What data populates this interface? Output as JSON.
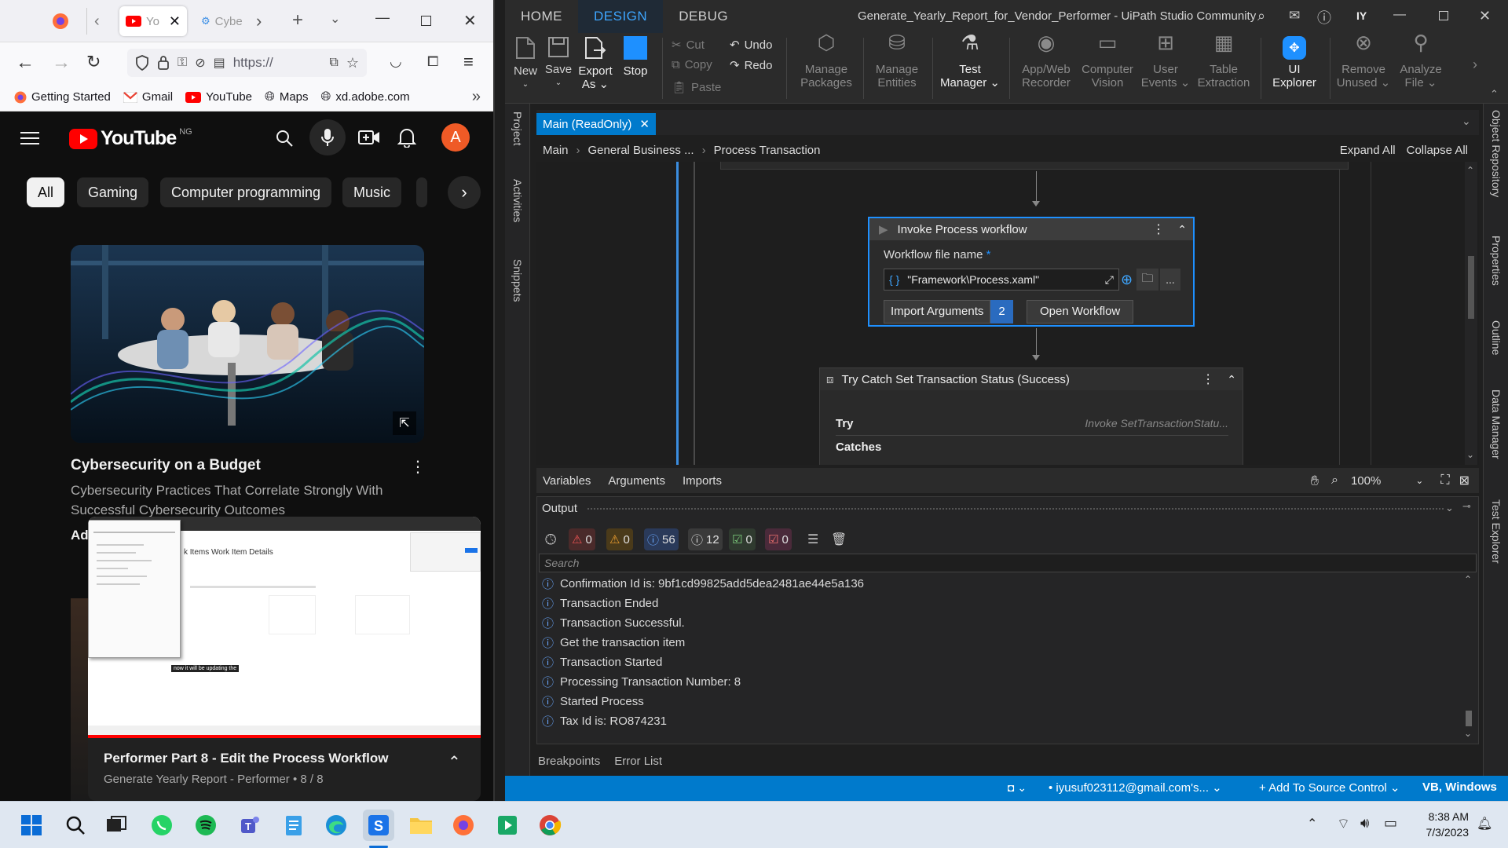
{
  "firefox": {
    "tabs": [
      {
        "label": "Yo"
      },
      {
        "label": "Cybe"
      }
    ],
    "url": "https://",
    "bookmarks": [
      "Getting Started",
      "Gmail",
      "YouTube",
      "Maps",
      "xd.adobe.com"
    ]
  },
  "youtube": {
    "logo_text": "YouTube",
    "country": "NG",
    "avatar_letter": "A",
    "chips": [
      "All",
      "Gaming",
      "Computer programming",
      "Music"
    ],
    "video1": {
      "title": "Cybersecurity on a Budget",
      "desc": "Cybersecurity Practices That Correlate Strongly With Successful Cybersecurity Outcomes",
      "ad": "Ad"
    },
    "miniplayer": {
      "title": "Performer Part 8  - Edit the Process Workflow",
      "subtitle": "Generate Yearly Report - Performer • 8 / 8",
      "caption": "now it will be updating the",
      "frame_tabs": "k Items   Work Item Details"
    }
  },
  "uipath": {
    "menu_tabs": [
      "HOME",
      "DESIGN",
      "DEBUG"
    ],
    "title": "Generate_Yearly_Report_for_Vendor_Performer - UiPath Studio Community",
    "user": "IY",
    "ribbon": {
      "new": "New",
      "save": "Save",
      "export": "Export",
      "export2": "As",
      "stop": "Stop",
      "cut": "Cut",
      "copy": "Copy",
      "paste": "Paste",
      "undo": "Undo",
      "redo": "Redo",
      "manage_packages": [
        "Manage",
        "Packages"
      ],
      "manage_entities": [
        "Manage",
        "Entities"
      ],
      "test_manager": [
        "Test",
        "Manager"
      ],
      "app_web_recorder": [
        "App/Web",
        "Recorder"
      ],
      "computer_vision": [
        "Computer",
        "Vision"
      ],
      "user_events": [
        "User",
        "Events"
      ],
      "table_extraction": [
        "Table",
        "Extraction"
      ],
      "ui_explorer": [
        "UI",
        "Explorer"
      ],
      "remove_unused": [
        "Remove",
        "Unused"
      ],
      "analyze_file": [
        "Analyze",
        "File"
      ]
    },
    "left_panels": [
      "Project",
      "Activities",
      "Snippets"
    ],
    "right_panels": [
      "Object Repository",
      "Properties",
      "Outline",
      "Data Manager",
      "Test Explorer"
    ],
    "doc_tab": "Main (ReadOnly)",
    "breadcrumb": [
      "Main",
      "General Business ...",
      "Process Transaction"
    ],
    "expand_all": "Expand All",
    "collapse_all": "Collapse All",
    "invoke": {
      "title": "Invoke Process workflow",
      "field_label": "Workflow file name",
      "required": "*",
      "value": "\"Framework\\Process.xaml\"",
      "import_args": "Import Arguments",
      "arg_count": "2",
      "open_workflow": "Open Workflow"
    },
    "trycatch": {
      "title": "Try Catch Set Transaction Status (Success)",
      "try": "Try",
      "try_value": "Invoke SetTransactionStatu...",
      "catches": "Catches"
    },
    "var_tabs": [
      "Variables",
      "Arguments",
      "Imports"
    ],
    "zoom": "100%",
    "output": {
      "title": "Output",
      "counts": {
        "errors": "0",
        "warnings": "0",
        "info": "56",
        "trace": "12",
        "success": "0",
        "failed": "0"
      },
      "search_placeholder": "Search",
      "lines": [
        "Confirmation Id is: 9bf1cd99825add5dea2481ae44e5a136",
        "Transaction Ended",
        "Transaction Successful.",
        "Get the transaction item",
        "Transaction Started",
        "Processing Transaction Number: 8",
        "Started Process",
        "Tax Id is: RO874231"
      ]
    },
    "bottom_tabs": [
      "Breakpoints",
      "Error List"
    ],
    "status": {
      "account": "iyusuf023112@gmail.com's...",
      "source_control": "Add To Source Control",
      "lang": "VB, Windows"
    }
  },
  "taskbar": {
    "time": "8:38 AM",
    "date": "7/3/2023"
  },
  "colors": {
    "accent_blue": "#007acc",
    "youtube_red": "#ff0000",
    "avatar_orange": "#ef5a26",
    "uipath_link": "#3ea6ff"
  }
}
